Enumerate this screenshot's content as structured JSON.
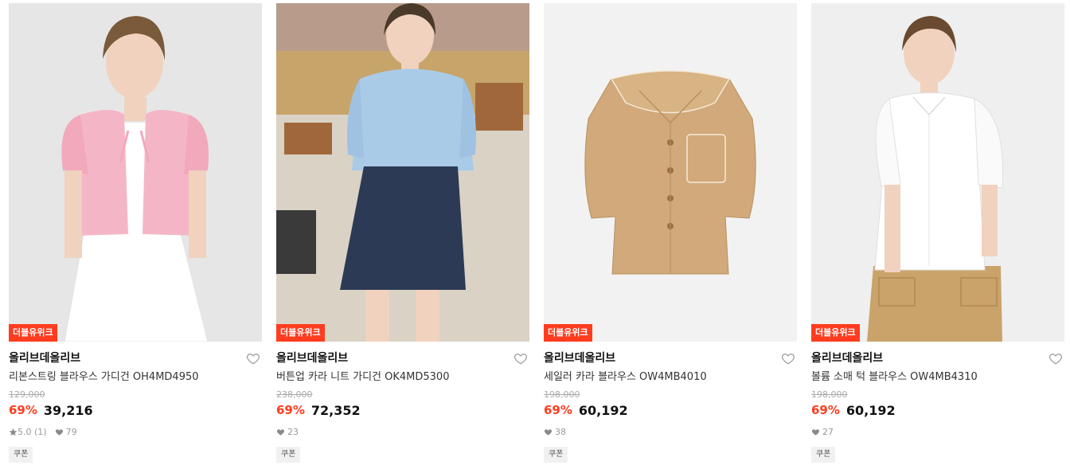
{
  "products": [
    {
      "badge": "더블유위크",
      "brand": "올리브데올리브",
      "name": "리본스트링 블라우스 가디건 OH4MD4950",
      "original_price": "129,000",
      "discount": "69%",
      "price": "39,216",
      "rating": "5.0 (1)",
      "likes": "79",
      "coupon": "쿠폰",
      "colors": {
        "bg": "#ededed",
        "top": "#f4b6c6",
        "bottom": "#ffffff",
        "skin": "#f0d2be",
        "hair": "#7a5a3a"
      }
    },
    {
      "badge": "더블유위크",
      "brand": "올리브데올리브",
      "name": "버튼업 카라 니트 가디건 OK4MD5300",
      "original_price": "238,000",
      "discount": "69%",
      "price": "72,352",
      "likes": "23",
      "coupon": "쿠폰",
      "colors": {
        "bg": "#c9a97a",
        "top": "#a9cbe8",
        "bottom": "#2c3a55",
        "skin": "#f0d2be",
        "hair": "#4a3a2a"
      }
    },
    {
      "badge": "더블유위크",
      "brand": "올리브데올리브",
      "name": "세일러 카라 블라우스 OW4MB4010",
      "original_price": "198,000",
      "discount": "69%",
      "price": "60,192",
      "likes": "38",
      "coupon": "쿠폰",
      "colors": {
        "bg": "#f2f2f2",
        "top": "#d1a97a"
      }
    },
    {
      "badge": "더블유위크",
      "brand": "올리브데올리브",
      "name": "볼륨 소매 턱 블라우스 OW4MB4310",
      "original_price": "198,000",
      "discount": "69%",
      "price": "60,192",
      "likes": "27",
      "coupon": "쿠폰",
      "colors": {
        "bg": "#efefef",
        "top": "#ffffff",
        "bottom": "#c9a36a",
        "skin": "#f0d2be",
        "hair": "#6a4a30"
      }
    }
  ],
  "icons": {
    "heart": "heart-icon",
    "star": "star-icon",
    "like": "heart-small-icon"
  },
  "accent_color": "#ff3c1f"
}
